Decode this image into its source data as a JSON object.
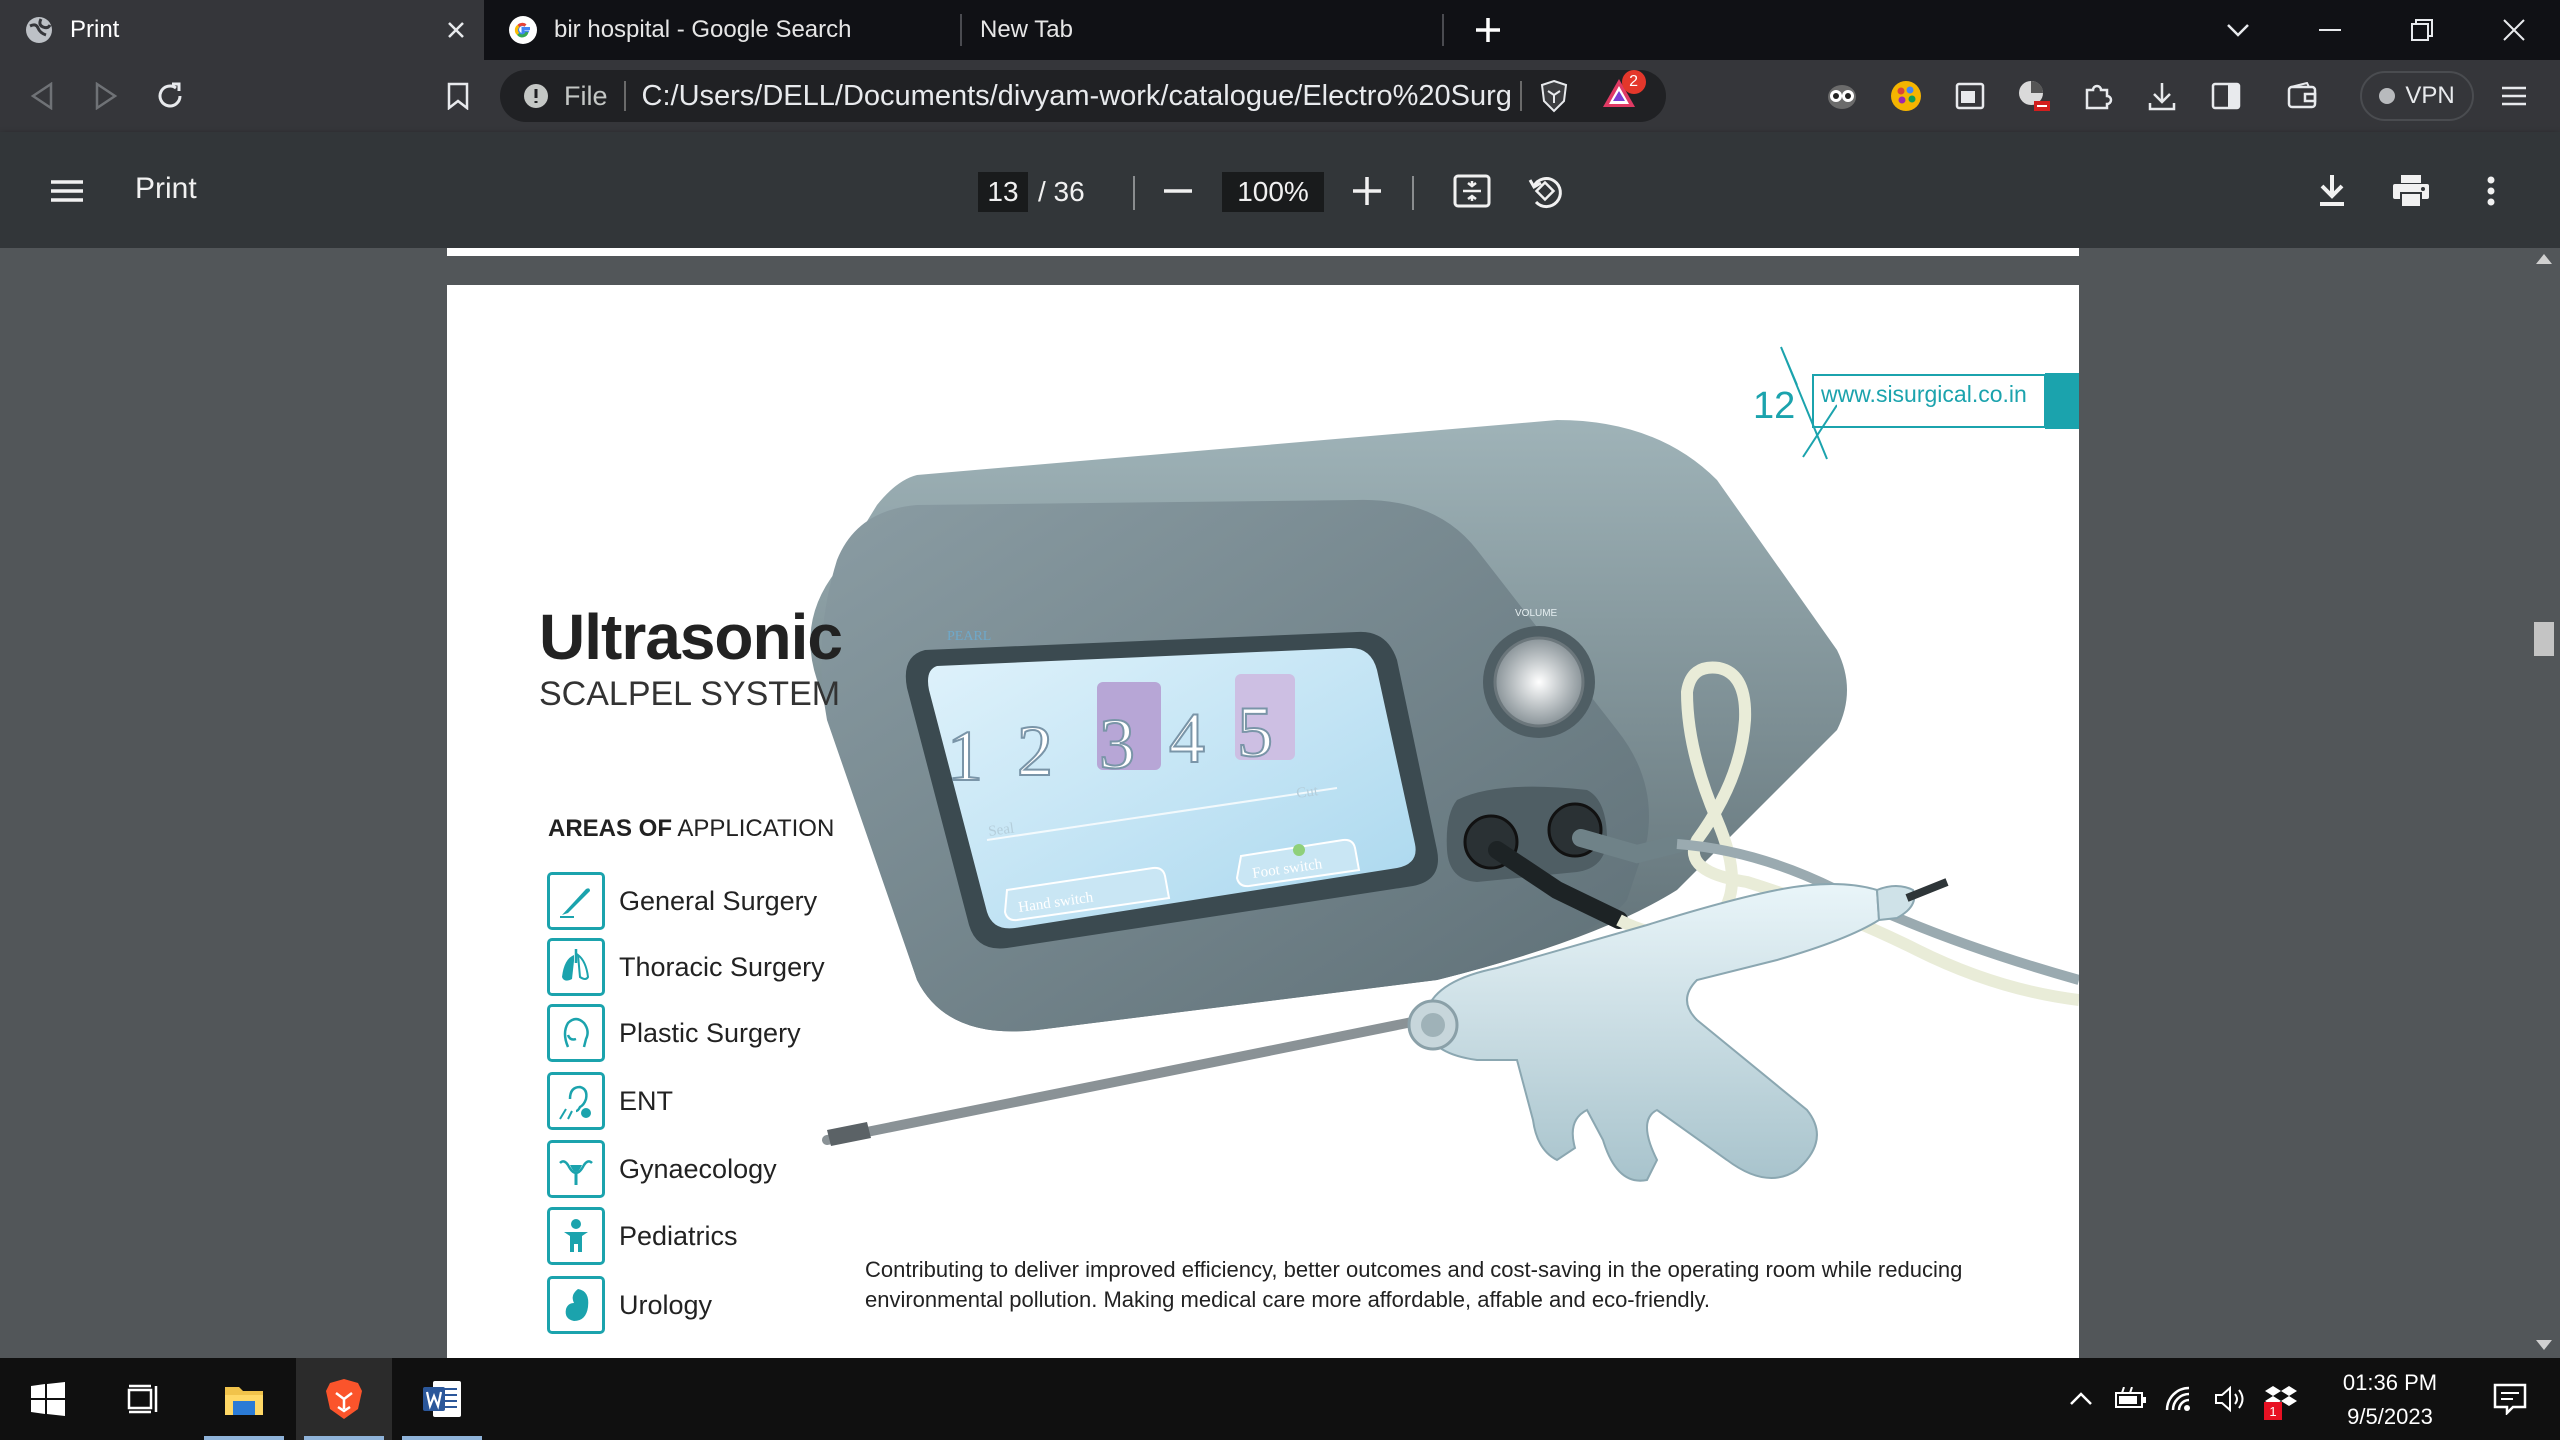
{
  "tabs": [
    {
      "label": "Print",
      "active": true
    },
    {
      "label": "bir hospital - Google Search",
      "active": false
    },
    {
      "label": "New Tab",
      "active": false
    }
  ],
  "omnibox": {
    "protocol": "File",
    "url": "C:/Users/DELL/Documents/divyam-work/catalogue/Electro%20Surgi..."
  },
  "toolbar": {
    "brave_rewards_badge": "2",
    "vpn_label": "VPN"
  },
  "pdf": {
    "title": "Print",
    "current_page": "13",
    "total_pages": "/ 36",
    "zoom": "100%"
  },
  "page_content": {
    "page_number": "12",
    "website": "www.sisurgical.co.in",
    "heading": "Ultrasonic",
    "subheading": "SCALPEL SYSTEM",
    "areas_title_bold": "AREAS OF",
    "areas_title_rest": " APPLICATION",
    "areas": [
      {
        "label": "General Surgery",
        "icon": "scalpel-icon"
      },
      {
        "label": "Thoracic Surgery",
        "icon": "lungs-icon"
      },
      {
        "label": "Plastic Surgery",
        "icon": "face-outline-icon"
      },
      {
        "label": "ENT",
        "icon": "ear-icon"
      },
      {
        "label": "Gynaecology",
        "icon": "uterus-icon"
      },
      {
        "label": "Pediatrics",
        "icon": "child-icon"
      },
      {
        "label": "Urology",
        "icon": "kidney-icon"
      }
    ],
    "caption": "Contributing to deliver improved efficiency, better outcomes and cost-saving in the operating room while reducing environmental pollution. Making medical care more affordable, affable and eco-friendly.",
    "device_screen": {
      "brand": "PEARL",
      "levels": [
        "1",
        "2",
        "3",
        "4",
        "5"
      ],
      "seal_label": "Seal",
      "cut_label": "Cut",
      "hand_switch": "Hand switch",
      "foot_switch": "Foot switch",
      "volume_label": "VOLUME"
    }
  },
  "taskbar": {
    "time": "01:36 PM",
    "date": "9/5/2023",
    "notification_badge": "1"
  },
  "colors": {
    "accent_teal": "#1ba3ad",
    "tab_bar": "#101115",
    "toolbar": "#35363a",
    "pdf_toolbar": "#323639",
    "viewer_bg": "#525659"
  }
}
